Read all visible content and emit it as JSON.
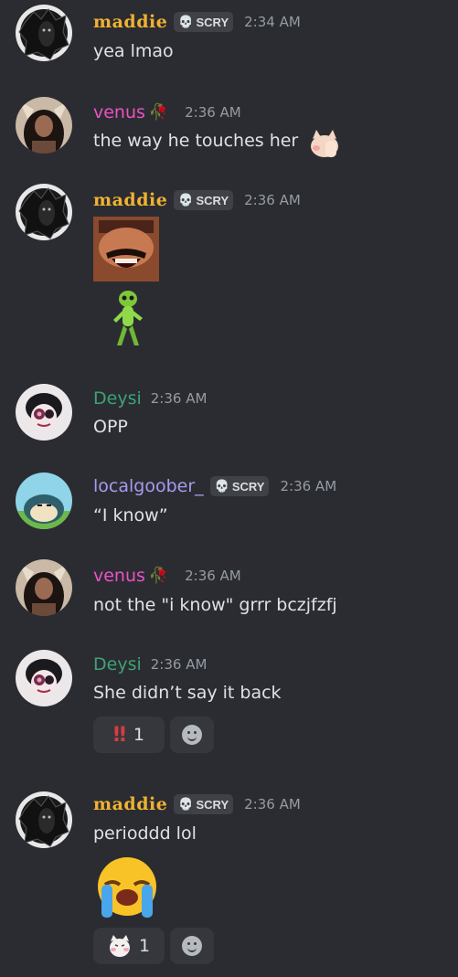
{
  "messages": [
    {
      "user": "maddie",
      "tag": "SCRY",
      "time": "2:34 AM",
      "text": "yea lmao"
    },
    {
      "user": "venus",
      "time": "2:36 AM",
      "text": "the way he touches her"
    },
    {
      "user": "maddie",
      "tag": "SCRY",
      "time": "2:36 AM"
    },
    {
      "user": "Deysi",
      "time": "2:36 AM",
      "text": "OPP"
    },
    {
      "user": "localgoober_",
      "tag": "SCRY",
      "time": "2:36 AM",
      "text": "“I know”"
    },
    {
      "user": "venus",
      "time": "2:36 AM",
      "text": "not the \"i know\" grrr bczjfzfj"
    },
    {
      "user": "Deysi",
      "time": "2:36 AM",
      "text": "She didn’t say it back",
      "reaction": {
        "emoji": "‼",
        "count": "1"
      }
    },
    {
      "user": "maddie",
      "tag": "SCRY",
      "time": "2:36 AM",
      "text": "perioddd lol",
      "reaction": {
        "emoji": "cat",
        "count": "1"
      }
    }
  ],
  "colors": {
    "maddie": "#f0b232",
    "venus": "#eb52c4",
    "deysi": "#3ca374",
    "localgoober": "#a59bf0",
    "background": "#2b2c31"
  },
  "icons": {
    "tag_icon": "skull-icon",
    "add_reaction": "smiley-icon"
  }
}
